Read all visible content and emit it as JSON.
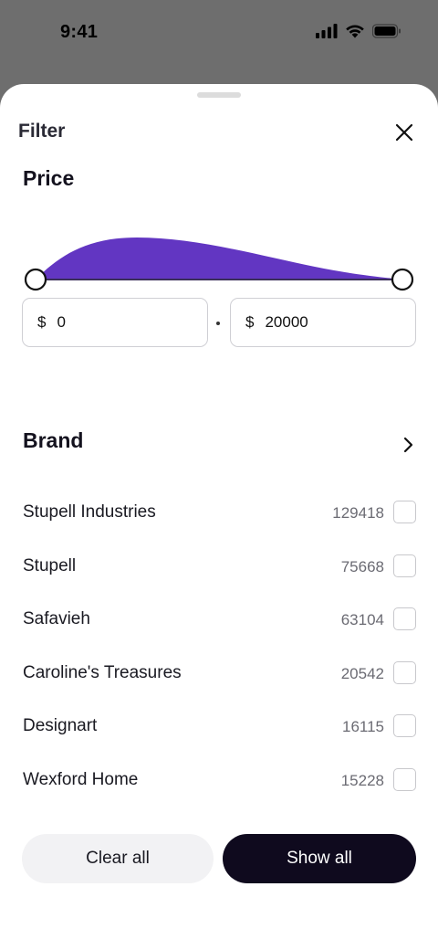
{
  "status_bar": {
    "time": "9:41"
  },
  "sheet": {
    "title": "Filter"
  },
  "price": {
    "title": "Price",
    "min_currency": "$",
    "min_value": "0",
    "max_currency": "$",
    "max_value": "20000",
    "accent_color": "#6236c2"
  },
  "brand": {
    "title": "Brand",
    "items": [
      {
        "name": "Stupell Industries",
        "count": "129418"
      },
      {
        "name": "Stupell",
        "count": "75668"
      },
      {
        "name": "Safavieh",
        "count": "63104"
      },
      {
        "name": "Caroline's Treasures",
        "count": "20542"
      },
      {
        "name": "Designart",
        "count": "16115"
      },
      {
        "name": "Wexford Home",
        "count": "15228"
      }
    ]
  },
  "actions": {
    "clear_label": "Clear all",
    "show_label": "Show all"
  }
}
